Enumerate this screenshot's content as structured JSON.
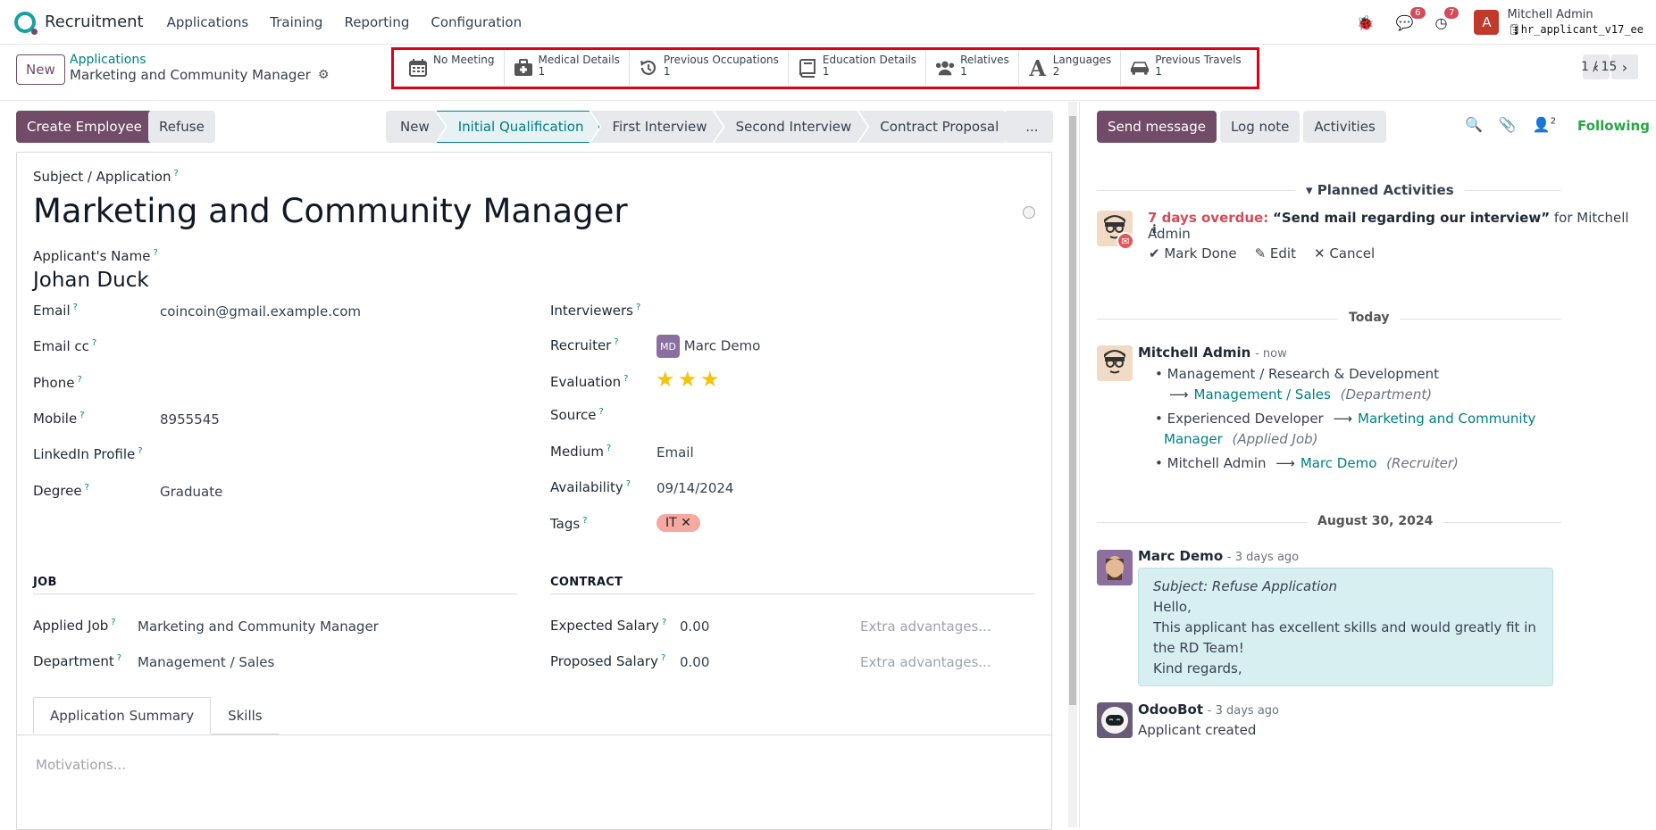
{
  "navbar": {
    "app_name": "Recruitment",
    "menu": [
      "Applications",
      "Training",
      "Reporting",
      "Configuration"
    ],
    "messages_badge": "6",
    "activities_badge": "7",
    "avatar_letter": "A",
    "user_name": "Mitchell Admin",
    "db_name": "hr_applicant_v17_ee"
  },
  "control_panel": {
    "new_label": "New",
    "breadcrumb_parent": "Applications",
    "breadcrumb_current": "Marketing and Community Manager",
    "pager_value": "1 / 15",
    "smart_buttons": [
      {
        "label": "No Meeting",
        "count": "",
        "icon": "calendar-icon"
      },
      {
        "label": "Medical Details",
        "count": "1",
        "icon": "medkit-icon"
      },
      {
        "label": "Previous Occupations",
        "count": "1",
        "icon": "history-icon"
      },
      {
        "label": "Education Details",
        "count": "1",
        "icon": "book-icon"
      },
      {
        "label": "Relatives",
        "count": "1",
        "icon": "users-icon"
      },
      {
        "label": "Languages",
        "count": "2",
        "icon": "font-icon"
      },
      {
        "label": "Previous Travels",
        "count": "1",
        "icon": "car-icon"
      }
    ]
  },
  "statusbar": {
    "create_employee": "Create Employee",
    "refuse": "Refuse",
    "stages": [
      "New",
      "Initial Qualification",
      "First Interview",
      "Second Interview",
      "Contract Proposal",
      "..."
    ],
    "active_stage": "Initial Qualification"
  },
  "form": {
    "subject_label": "Subject / Application",
    "title": "Marketing and Community Manager",
    "applicant_label": "Applicant's Name",
    "applicant_name": "Johan Duck",
    "email_label": "Email",
    "email": "coincoin@gmail.example.com",
    "email_cc_label": "Email cc",
    "phone_label": "Phone",
    "mobile_label": "Mobile",
    "mobile": "8955545",
    "linkedin_label": "LinkedIn Profile",
    "degree_label": "Degree",
    "degree": "Graduate",
    "interviewers_label": "Interviewers",
    "recruiter_label": "Recruiter",
    "recruiter": "Marc Demo",
    "evaluation_label": "Evaluation",
    "evaluation_stars": 3,
    "source_label": "Source",
    "medium_label": "Medium",
    "medium": "Email",
    "availability_label": "Availability",
    "availability": "09/14/2024",
    "tags_label": "Tags",
    "tag": "IT",
    "job_header": "JOB",
    "contract_header": "CONTRACT",
    "applied_job_label": "Applied Job",
    "applied_job": "Marketing and Community Manager",
    "department_label": "Department",
    "department": "Management / Sales",
    "expected_salary_label": "Expected Salary",
    "expected_salary": "0.00",
    "proposed_salary_label": "Proposed Salary",
    "proposed_salary": "0.00",
    "extra_placeholder": "Extra advantages...",
    "tabs": [
      "Application Summary",
      "Skills"
    ],
    "motivations_placeholder": "Motivations..."
  },
  "chatter": {
    "send_message": "Send message",
    "log_note": "Log note",
    "activities": "Activities",
    "followers_count": "2",
    "following": "Following",
    "planned_activities": "Planned Activities",
    "overdue": "7 days overdue:",
    "activity_summary": "“Send mail regarding our interview”",
    "activity_for": "for Mitchell Admin",
    "mark_done": "Mark Done",
    "edit": "Edit",
    "cancel": "Cancel",
    "today": "Today",
    "msg1_author": "Mitchell Admin",
    "msg1_time": "- now",
    "changes": [
      {
        "old": "Management / Research & Development",
        "new": "Management / Sales",
        "field": "(Department)"
      },
      {
        "old": "Experienced Developer",
        "new": "Marketing and Community Manager",
        "field": "(Applied Job)"
      },
      {
        "old": "Mitchell Admin",
        "new": "Marc Demo",
        "field": "(Recruiter)"
      }
    ],
    "date2": "August 30, 2024",
    "msg2_author": "Marc Demo",
    "msg2_time": "- 3 days ago",
    "msg2_subject": "Subject: Refuse Application",
    "msg2_lines": [
      "Hello,",
      "This applicant has excellent skills and would greatly fit in the RD Team!",
      "Kind regards,"
    ],
    "msg3_author": "OdooBot",
    "msg3_time": "- 3 days ago",
    "msg3_body": "Applicant created"
  }
}
